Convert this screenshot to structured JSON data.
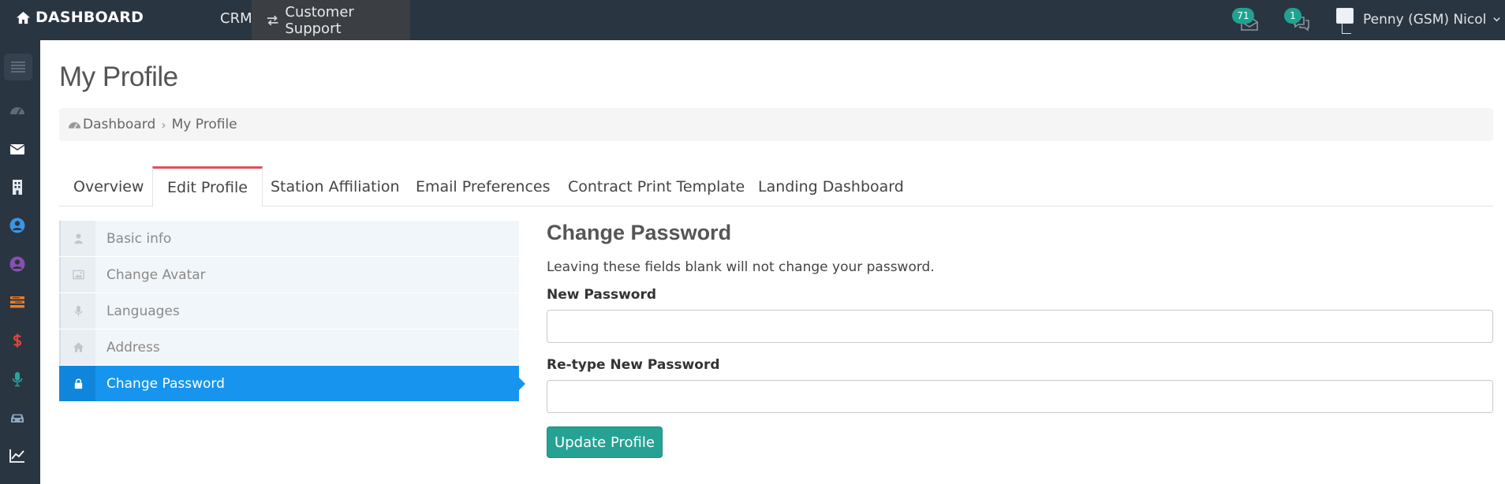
{
  "topbar": {
    "brand": "DASHBOARD",
    "nav_crm": "CRM",
    "nav_support": "Customer Support",
    "mail_count": "71",
    "chat_count": "1",
    "user_name": "Penny (GSM) Nicol"
  },
  "sidebar": {
    "icons": [
      "menu-icon",
      "speedometer-icon",
      "envelope-icon",
      "building-icon",
      "user-circle-icon",
      "user-circle-icon",
      "stack-icon",
      "dollar-icon",
      "microphone-icon",
      "car-icon",
      "line-chart-icon"
    ],
    "colors": {
      "user_blue": "#3d95e0",
      "user_purple": "#8a4fb0",
      "stack_orange": "#ee7d23",
      "dollar_red": "#e8433a",
      "mic_green": "#26a69a"
    }
  },
  "page": {
    "title": "My Profile",
    "breadcrumb": {
      "home": "Dashboard",
      "current": "My Profile"
    }
  },
  "tabs": [
    "Overview",
    "Edit Profile",
    "Station Affiliation",
    "Email Preferences",
    "Contract Print Template",
    "Landing Dashboard"
  ],
  "active_tab": "Edit Profile",
  "menu": {
    "items": [
      {
        "label": "Basic info",
        "icon": "user-icon"
      },
      {
        "label": "Change Avatar",
        "icon": "image-icon"
      },
      {
        "label": "Languages",
        "icon": "microphone-icon"
      },
      {
        "label": "Address",
        "icon": "home-icon"
      },
      {
        "label": "Change Password",
        "icon": "lock-icon"
      }
    ],
    "active": "Change Password"
  },
  "form": {
    "title": "Change Password",
    "note": "Leaving these fields blank will not change your password.",
    "new_password_label": "New Password",
    "new_password_value": "",
    "retype_label": "Re-type New Password",
    "retype_value": "",
    "submit_label": "Update Profile"
  },
  "colors": {
    "topbar": "#2a3542",
    "active_tab_border": "#e0505c",
    "active_menu": "#1795ee",
    "primary_button": "#25a293",
    "badge": "#1fa391"
  }
}
